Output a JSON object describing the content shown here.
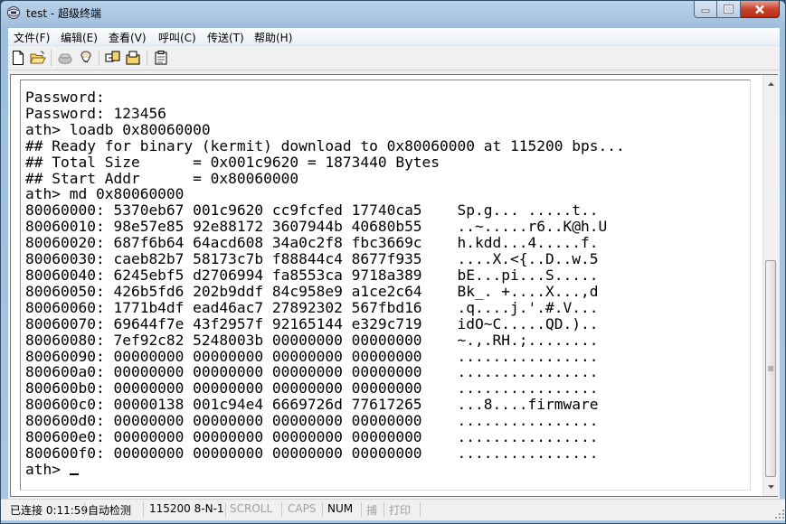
{
  "window": {
    "title": "test - 超级终端",
    "app_icon": "hyperterminal-icon",
    "buttons": [
      "minimize-icon",
      "maximize-icon",
      "close-icon"
    ]
  },
  "menu": {
    "items": [
      "文件(F)",
      "编辑(E)",
      "查看(V)",
      "呼叫(C)",
      "传送(T)",
      "帮助(H)"
    ]
  },
  "toolbar": {
    "buttons": [
      "new-file-icon",
      "open-folder-icon",
      "connect-phone-icon",
      "disconnect-icon",
      "send-file-icon",
      "receive-file-icon",
      "properties-icon"
    ]
  },
  "terminal": {
    "lines": [
      "Password:",
      "Password: 123456",
      "ath> loadb 0x80060000",
      "## Ready for binary (kermit) download to 0x80060000 at 115200 bps...",
      "## Total Size      = 0x001c9620 = 1873440 Bytes",
      "## Start Addr      = 0x80060000",
      "ath> md 0x80060000",
      "80060000: 5370eb67 001c9620 cc9fcfed 17740ca5    Sp.g... .....t..",
      "80060010: 98e57e85 92e88172 3607944b 40680b55    ..~.....r6..K@h.U",
      "80060020: 687f6b64 64acd608 34a0c2f8 fbc3669c    h.kdd...4.....f.",
      "80060030: caeb82b7 58173c7b f88844c4 8677f935    ....X.<{..D..w.5",
      "80060040: 6245ebf5 d2706994 fa8553ca 9718a389    bE...pi...S.....",
      "80060050: 426b5fd6 202b9ddf 84c958e9 a1ce2c64    Bk_. +....X...,d",
      "80060060: 1771b4df ead46ac7 27892302 567fbd16    .q....j.'.#.V...",
      "80060070: 69644f7e 43f2957f 92165144 e329c719    idO~C.....QD.)..",
      "80060080: 7ef92c82 5248003b 00000000 00000000    ~.,.RH.;........",
      "80060090: 00000000 00000000 00000000 00000000    ................",
      "800600a0: 00000000 00000000 00000000 00000000    ................",
      "800600b0: 00000000 00000000 00000000 00000000    ................",
      "800600c0: 00000138 001c94e4 6669726d 77617265    ...8....firmware",
      "800600d0: 00000000 00000000 00000000 00000000    ................",
      "800600e0: 00000000 00000000 00000000 00000000    ................",
      "800600f0: 00000000 00000000 00000000 00000000    ................",
      "ath> "
    ]
  },
  "status": {
    "connection": "已连接 0:11:59",
    "detect": "自动检测",
    "settings": "115200 8-N-1",
    "scroll": "SCROLL",
    "caps": "CAPS",
    "num": "NUM",
    "capture": "捕",
    "print": "打印"
  }
}
